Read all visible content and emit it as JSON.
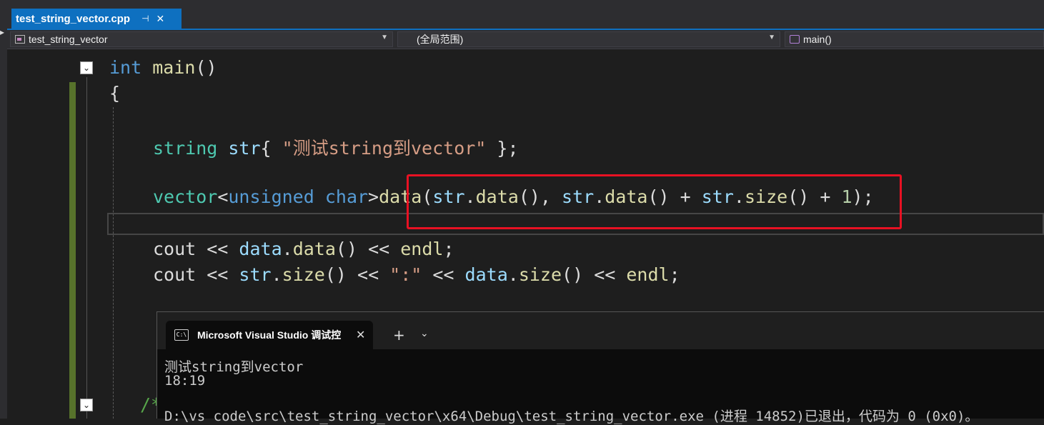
{
  "tab": {
    "title": "test_string_vector.cpp",
    "pin_icon": "pin-icon",
    "close_icon": "close-icon"
  },
  "navbar": {
    "project": "test_string_vector",
    "scope": "(全局范围)",
    "member": "main()"
  },
  "code": {
    "kw_int": "int",
    "fn_main": "main",
    "parens": "()",
    "brace_open": "{",
    "line3_type": "string",
    "line3_var": "str",
    "line3_brace": "{ ",
    "line3_str": "\"测试string到vector\"",
    "line3_end": " };",
    "line5_type": "vector",
    "line5_lt": "<",
    "line5_kw": "unsigned char",
    "line5_gt": ">",
    "line5_fn": "data",
    "line5_p1": "(",
    "line5_v1": "str",
    "line5_d1": ".",
    "line5_f1": "data",
    "line5_p2": "(), ",
    "line5_v2": "str",
    "line5_d2": ".",
    "line5_f2": "data",
    "line5_p3": "() + ",
    "line5_v3": "str",
    "line5_d3": ".",
    "line5_f3": "size",
    "line5_p4": "() + ",
    "line5_num": "1",
    "line5_end": ");",
    "line7_a": "cout << ",
    "line7_v": "data",
    "line7_d": ".",
    "line7_f": "data",
    "line7_p": "() << ",
    "line7_e": "endl",
    "line7_end": ";",
    "line8_a": "cout << ",
    "line8_v": "str",
    "line8_d": ".",
    "line8_f": "size",
    "line8_p": "() << ",
    "line8_s": "\":\"",
    "line8_m": " << ",
    "line8_v2": "data",
    "line8_d2": ".",
    "line8_f2": "size",
    "line8_p2": "() << ",
    "line8_e": "endl",
    "line8_end": ";",
    "comment_fragment": "/*"
  },
  "terminal": {
    "icon_text": "C:\\",
    "title": "Microsoft Visual Studio 调试控",
    "add_label": "+",
    "dropdown_label": "⌄",
    "close_label": "✕",
    "output": [
      "测试string到vector",
      "18:19",
      "",
      "D:\\vs code\\src\\test_string_vector\\x64\\Debug\\test_string_vector.exe (进程 14852)已退出，代码为 0 (0x0)。"
    ]
  },
  "colors": {
    "accent": "#0e70c0",
    "highlight_box": "#e81123",
    "change_bar": "#57722b"
  }
}
